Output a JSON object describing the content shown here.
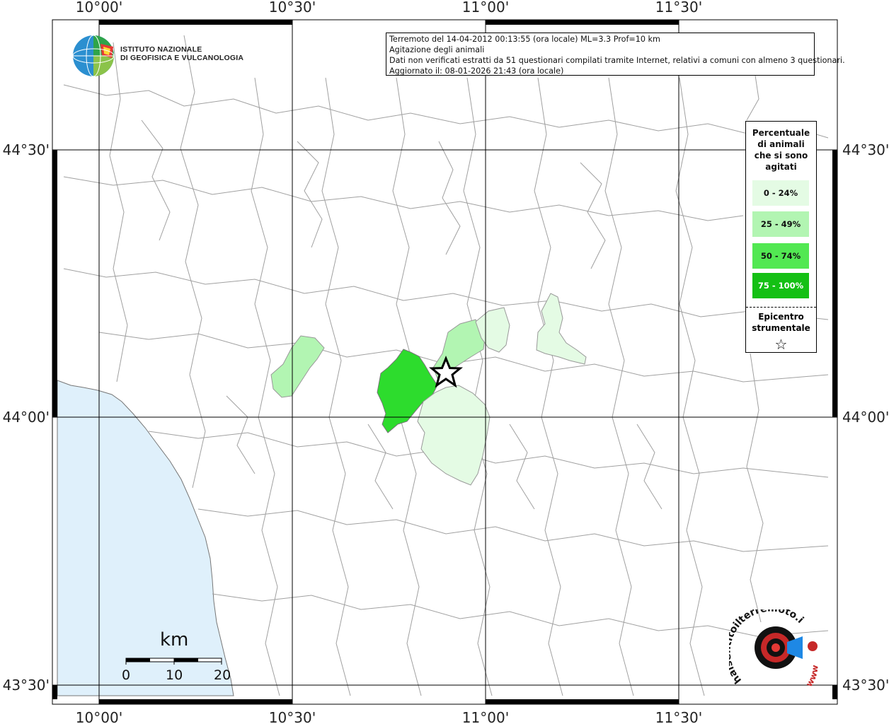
{
  "info_box": {
    "line1": "Terremoto del 14-04-2012 00:13:55 (ora locale) ML=3.3 Prof=10 km",
    "line2": "Agitazione degli animali",
    "line3": "Dati non verificati estratti da 51 questionari compilati tramite Internet, relativi a comuni con almeno 3 questionari.",
    "line4": "Aggiornato il: 08-01-2026 21:43 (ora locale)"
  },
  "institute": {
    "line1": "ISTITUTO NAZIONALE",
    "line2": "DI GEOFISICA E VULCANOLOGIA"
  },
  "axes": {
    "top": [
      "10°00'",
      "10°30'",
      "11°00'",
      "11°30'"
    ],
    "bottom": [
      "10°00'",
      "10°30'",
      "11°00'",
      "11°30'"
    ],
    "left": [
      "44°30'",
      "44°00'",
      "43°30'"
    ],
    "right": [
      "44°30'",
      "44°00'",
      "43°30'"
    ]
  },
  "legend": {
    "title_lines": [
      "Percentuale",
      "di animali",
      "che si sono",
      "agitati"
    ],
    "items": [
      {
        "label": "0 - 24%",
        "color": "#e4fbe4"
      },
      {
        "label": "25 - 49%",
        "color": "#b2f5b2"
      },
      {
        "label": "50 - 74%",
        "color": "#52e852"
      },
      {
        "label": "75 - 100%",
        "color": "#14c014"
      }
    ],
    "epicenter_lines": [
      "Epicentro",
      "strumentale"
    ],
    "epicenter_symbol": "☆"
  },
  "scale_bar": {
    "unit": "km",
    "labels": [
      "0",
      "10",
      "20"
    ]
  },
  "watermark": {
    "text": "haisentitoilterremoto.it",
    "url": "www"
  },
  "colors": {
    "sea": "#dff0fb",
    "land": "#ffffff",
    "borders": "#9a9a9a",
    "grid": "#000000"
  }
}
